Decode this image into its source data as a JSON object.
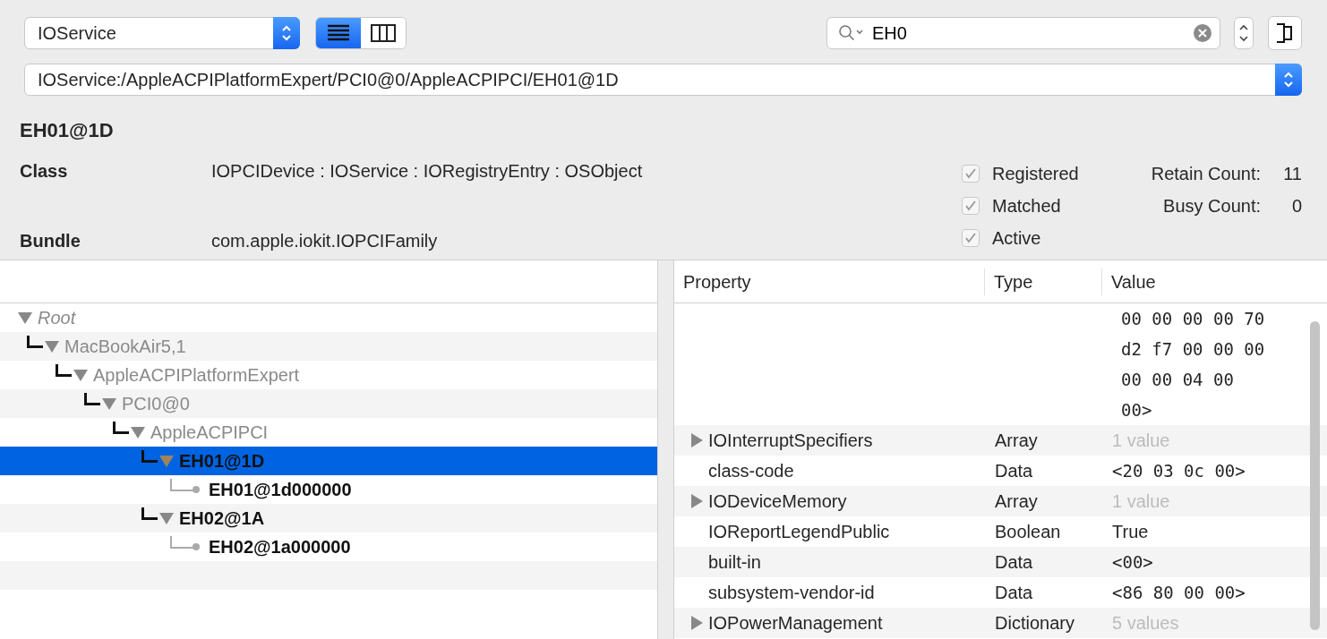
{
  "toolbar": {
    "plane_select": "IOService",
    "view_modes": [
      {
        "kind": "list",
        "selected": true
      },
      {
        "kind": "columns",
        "selected": false
      }
    ],
    "search": {
      "value": "EH0"
    }
  },
  "path": "IOService:/AppleACPIPlatformExpert/PCI0@0/AppleACPIPCI/EH01@1D",
  "details": {
    "title": "EH01@1D",
    "fields": [
      {
        "label": "Class",
        "value": "IOPCIDevice : IOService : IORegistryEntry : OSObject"
      },
      {
        "label": "Bundle",
        "value": "com.apple.iokit.IOPCIFamily"
      }
    ],
    "flags": [
      {
        "label": "Registered",
        "checked": true
      },
      {
        "label": "Matched",
        "checked": true
      },
      {
        "label": "Active",
        "checked": true
      }
    ],
    "counts": [
      {
        "label": "Retain Count:",
        "value": "11"
      },
      {
        "label": "Busy Count:",
        "value": "0"
      }
    ]
  },
  "tree": [
    {
      "name": "Root",
      "kind": "root",
      "matched": false,
      "selected": false,
      "expanded": true,
      "children": [
        {
          "name": "MacBookAir5,1",
          "kind": "node",
          "matched": false,
          "selected": false,
          "expanded": true,
          "children": [
            {
              "name": "AppleACPIPlatformExpert",
              "kind": "node",
              "matched": false,
              "selected": false,
              "expanded": true,
              "children": [
                {
                  "name": "PCI0@0",
                  "kind": "node",
                  "matched": false,
                  "selected": false,
                  "expanded": true,
                  "children": [
                    {
                      "name": "AppleACPIPCI",
                      "kind": "node",
                      "matched": false,
                      "selected": false,
                      "expanded": true,
                      "children": [
                        {
                          "name": "EH01@1D",
                          "kind": "node",
                          "matched": true,
                          "selected": true,
                          "expanded": true,
                          "children": [
                            {
                              "name": "EH01@1d000000",
                              "kind": "leaf",
                              "matched": true,
                              "selected": false
                            }
                          ]
                        },
                        {
                          "name": "EH02@1A",
                          "kind": "node",
                          "matched": true,
                          "selected": false,
                          "expanded": true,
                          "children": [
                            {
                              "name": "EH02@1a000000",
                              "kind": "leaf",
                              "matched": true,
                              "selected": false
                            }
                          ]
                        }
                      ]
                    }
                  ]
                }
              ]
            }
          ]
        }
      ]
    }
  ],
  "properties": {
    "columns": [
      "Property",
      "Type",
      "Value"
    ],
    "rows": [
      {
        "kind": "data",
        "property": "",
        "type": "",
        "value": [
          "00 00 00 00 70",
          "d2 f7 00 00 00",
          "00 00 04 00",
          "00>"
        ]
      },
      {
        "kind": "collection",
        "expanded": false,
        "property": "IOInterruptSpecifiers",
        "type": "Array",
        "value": [
          "1 value"
        ]
      },
      {
        "kind": "data",
        "property": "class-code",
        "type": "Data",
        "value": [
          "<20 03 0c 00>"
        ]
      },
      {
        "kind": "collection",
        "expanded": false,
        "property": "IODeviceMemory",
        "type": "Array",
        "value": [
          "1 value"
        ]
      },
      {
        "kind": "plain",
        "property": "IOReportLegendPublic",
        "type": "Boolean",
        "value": [
          "True"
        ]
      },
      {
        "kind": "data",
        "property": "built-in",
        "type": "Data",
        "value": [
          "<00>"
        ]
      },
      {
        "kind": "data",
        "property": "subsystem-vendor-id",
        "type": "Data",
        "value": [
          "<86 80 00 00>"
        ]
      },
      {
        "kind": "collection",
        "expanded": false,
        "property": "IOPowerManagement",
        "type": "Dictionary",
        "value": [
          "5 values"
        ]
      }
    ]
  }
}
